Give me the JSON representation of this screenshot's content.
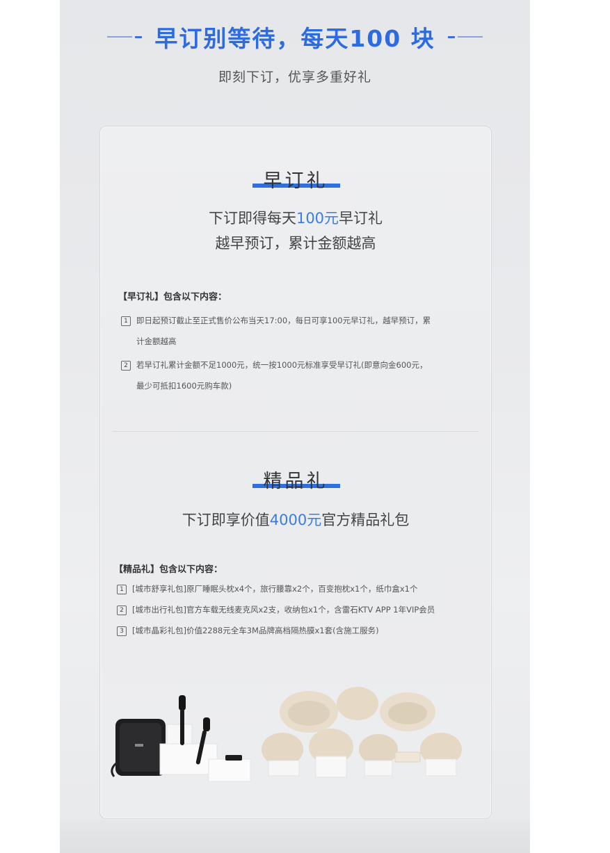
{
  "hero": {
    "title": "早订别等待，每天100 块",
    "subtitle": "即刻下订，优享多重好礼"
  },
  "early_gift": {
    "title": "早订礼",
    "lead_line1_prefix": "下订即得每天",
    "lead_line1_highlight": "100元",
    "lead_line1_suffix": "早订礼",
    "lead_line2": "越早预订，累计金额越高",
    "list_heading": "【早订礼】包含以下内容：",
    "items": [
      {
        "num": "1",
        "line1": "即日起预订截止至正式售价公布当天17:00，每日可享100元早订礼，越早预订，累",
        "line2": "计金额越高"
      },
      {
        "num": "2",
        "line1": "若早订礼累计金额不足1000元，统一按1000元标准享受早订礼(即意向金600元，",
        "line2": "最少可抵扣1600元购车款)"
      }
    ]
  },
  "premium_gift": {
    "title": "精品礼",
    "lead_prefix": "下订即享价值",
    "lead_highlight": "4000元",
    "lead_suffix": "官方精品礼包",
    "list_heading": "【精品礼】包含以下内容：",
    "items": [
      {
        "num": "1",
        "text": "[城市舒享礼包]原厂睡眠头枕x4个，旅行腰靠x2个，百变抱枕x1个，纸巾盒x1个"
      },
      {
        "num": "2",
        "text": "[城市出行礼包]官方车载无线麦克风x2支，收纳包x1个，含雷石KTV APP 1年VIP会员"
      },
      {
        "num": "3",
        "text": "[城市晶彩礼包]价值2288元全车3M品牌高档隔热膜x1套(含施工服务)"
      }
    ]
  },
  "colors": {
    "accent": "#2d6be0",
    "highlight": "#3a7be8"
  }
}
